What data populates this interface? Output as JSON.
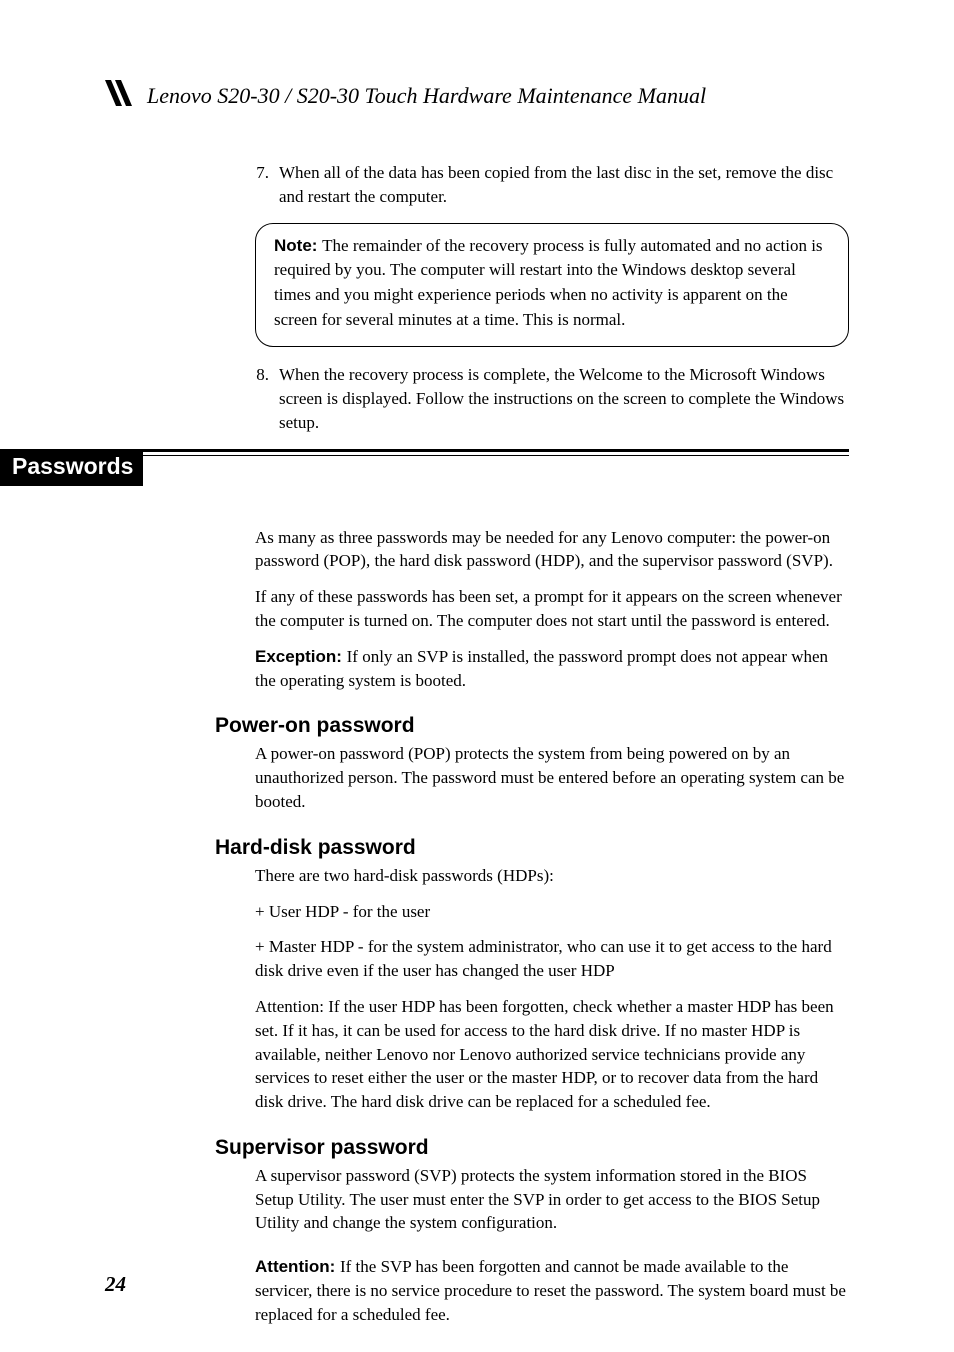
{
  "header": {
    "title": "Lenovo S20-30 / S20-30 Touch Hardware Maintenance Manual"
  },
  "steps": {
    "s7_num": "7.",
    "s7_text": "When all of the data has been copied from the last disc in the set, remove the disc and restart the computer.",
    "s8_num": "8.",
    "s8_text": "When the recovery process is complete, the Welcome to the Microsoft Windows screen is displayed. Follow the instructions on the screen to complete the Windows setup."
  },
  "note": {
    "label": "Note: ",
    "text": "The remainder of the recovery process is fully automated and no action is required by you. The computer will restart into the Windows desktop several times and you might experience periods when no activity is apparent on the screen for several minutes at a time. This is normal."
  },
  "section": {
    "title": "Passwords"
  },
  "intro": {
    "p1": "As many as three passwords may be needed for any Lenovo computer: the power-on password (POP), the hard disk password (HDP), and the supervisor password (SVP).",
    "p2": "If any of these passwords has been set, a prompt for it appears on the screen whenever the computer is turned on. The computer does not start until the password is entered.",
    "exc_label": "Exception: ",
    "exc_text": "If only an SVP is installed, the password prompt does not appear when the operating system is booted."
  },
  "pop": {
    "heading": "Power-on password",
    "text": "A power-on password (POP) protects the system from being powered on by an unauthorized person. The password must be entered before an operating system can be booted."
  },
  "hdp": {
    "heading": "Hard-disk password",
    "p1": "There are two hard-disk passwords (HDPs):",
    "l1": "+ User HDP - for the user",
    "l2": "+ Master HDP - for the system administrator, who can use it to get access to the hard disk drive even if the user has changed the user HDP",
    "p2": "Attention: If the user HDP has been forgotten, check whether a master HDP has been set. If it has, it can be used for access to the hard disk drive. If no master HDP is available, neither Lenovo nor Lenovo authorized service technicians provide any services to reset either the user or the master HDP, or to recover data from the hard disk drive. The hard disk drive can be replaced for a scheduled fee."
  },
  "svp": {
    "heading": "Supervisor password",
    "p1": "A supervisor password (SVP) protects the system information stored in the BIOS Setup Utility. The user must enter the SVP in order to get access to the BIOS Setup Utility and change the system configuration.",
    "att_label": "Attention: ",
    "att_text": "If the SVP has been forgotten and cannot be made available to the servicer, there is no service procedure to reset the password. The system board must be replaced for a scheduled fee."
  },
  "page_number": "24"
}
